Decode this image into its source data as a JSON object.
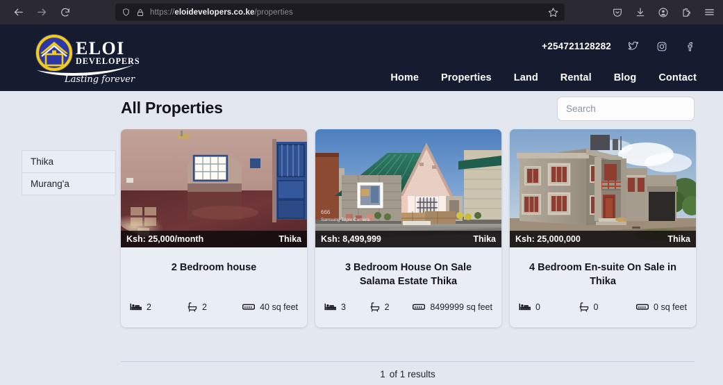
{
  "browser": {
    "url_scheme": "https://",
    "url_host": "eloidevelopers.co.ke",
    "url_path": "/properties",
    "back_icon": "back-arrow-icon",
    "forward_icon": "forward-arrow-icon",
    "reload_icon": "reload-icon",
    "shield_icon": "shield-icon",
    "lock_icon": "lock-icon",
    "bookmark_icon": "star-icon",
    "pocket_icon": "pocket-icon",
    "downloads_icon": "download-icon",
    "account_icon": "account-icon",
    "extensions_icon": "extensions-icon",
    "menu_icon": "hamburger-menu-icon"
  },
  "header": {
    "logo_title": "ELOI",
    "logo_subtitle": "DEVELOPERS",
    "logo_tagline": "Lasting forever",
    "phone": "+254721128282",
    "socials": [
      {
        "name": "twitter-icon"
      },
      {
        "name": "instagram-icon"
      },
      {
        "name": "facebook-icon"
      }
    ],
    "nav": [
      {
        "label": "Home"
      },
      {
        "label": "Properties"
      },
      {
        "label": "Land"
      },
      {
        "label": "Rental"
      },
      {
        "label": "Blog"
      },
      {
        "label": "Contact"
      }
    ]
  },
  "main": {
    "title": "All Properties",
    "search": {
      "placeholder": "Search",
      "value": ""
    },
    "locations": [
      {
        "label": "Thika"
      },
      {
        "label": "Murang'a"
      }
    ],
    "properties": [
      {
        "price": "Ksh: 25,000/month",
        "location": "Thika",
        "title": "2 Bedroom house",
        "beds": "2",
        "baths": "2",
        "area": "40 sq feet"
      },
      {
        "price": "Ksh: 8,499,999",
        "location": "Thika",
        "title": "3 Bedroom House On Sale Salama Estate Thika",
        "beds": "3",
        "baths": "2",
        "area": "8499999 sq feet",
        "watermark": "Samsung Triple Camera"
      },
      {
        "price": "Ksh: 25,000,000",
        "location": "Thika",
        "title": "4 Bedroom En-suite On Sale in Thika",
        "beds": "0",
        "baths": "0",
        "area": "0 sq feet"
      }
    ],
    "results": {
      "count": "1",
      "text": "of 1 results"
    }
  },
  "colors": {
    "header_navy": "#161c30",
    "page_bg": "#e3e8f0",
    "logo_yellow": "#f2cb1d",
    "logo_blue": "#2b39a8",
    "browser_chrome": "#2b2a33"
  }
}
